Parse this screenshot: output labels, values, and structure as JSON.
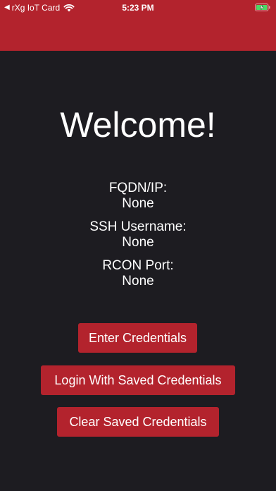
{
  "status_bar": {
    "back_arrow": "◀",
    "carrier": "rXg IoT Card",
    "time": "5:23 PM",
    "wifi_icon": "wifi-icon",
    "battery_icon": "battery-charging-icon"
  },
  "colors": {
    "header": "#b3232d",
    "background": "#1d1c21",
    "button": "#b3232d",
    "text": "#ffffff",
    "battery_fill": "#4cd964"
  },
  "main": {
    "title": "Welcome!",
    "fields": [
      {
        "label": "FQDN/IP:",
        "value": "None"
      },
      {
        "label": "SSH Username:",
        "value": "None"
      },
      {
        "label": "RCON Port:",
        "value": "None"
      }
    ],
    "buttons": {
      "enter_credentials": "Enter Credentials",
      "login_saved": "Login With Saved Credentials",
      "clear_saved": "Clear Saved Credentials"
    }
  }
}
